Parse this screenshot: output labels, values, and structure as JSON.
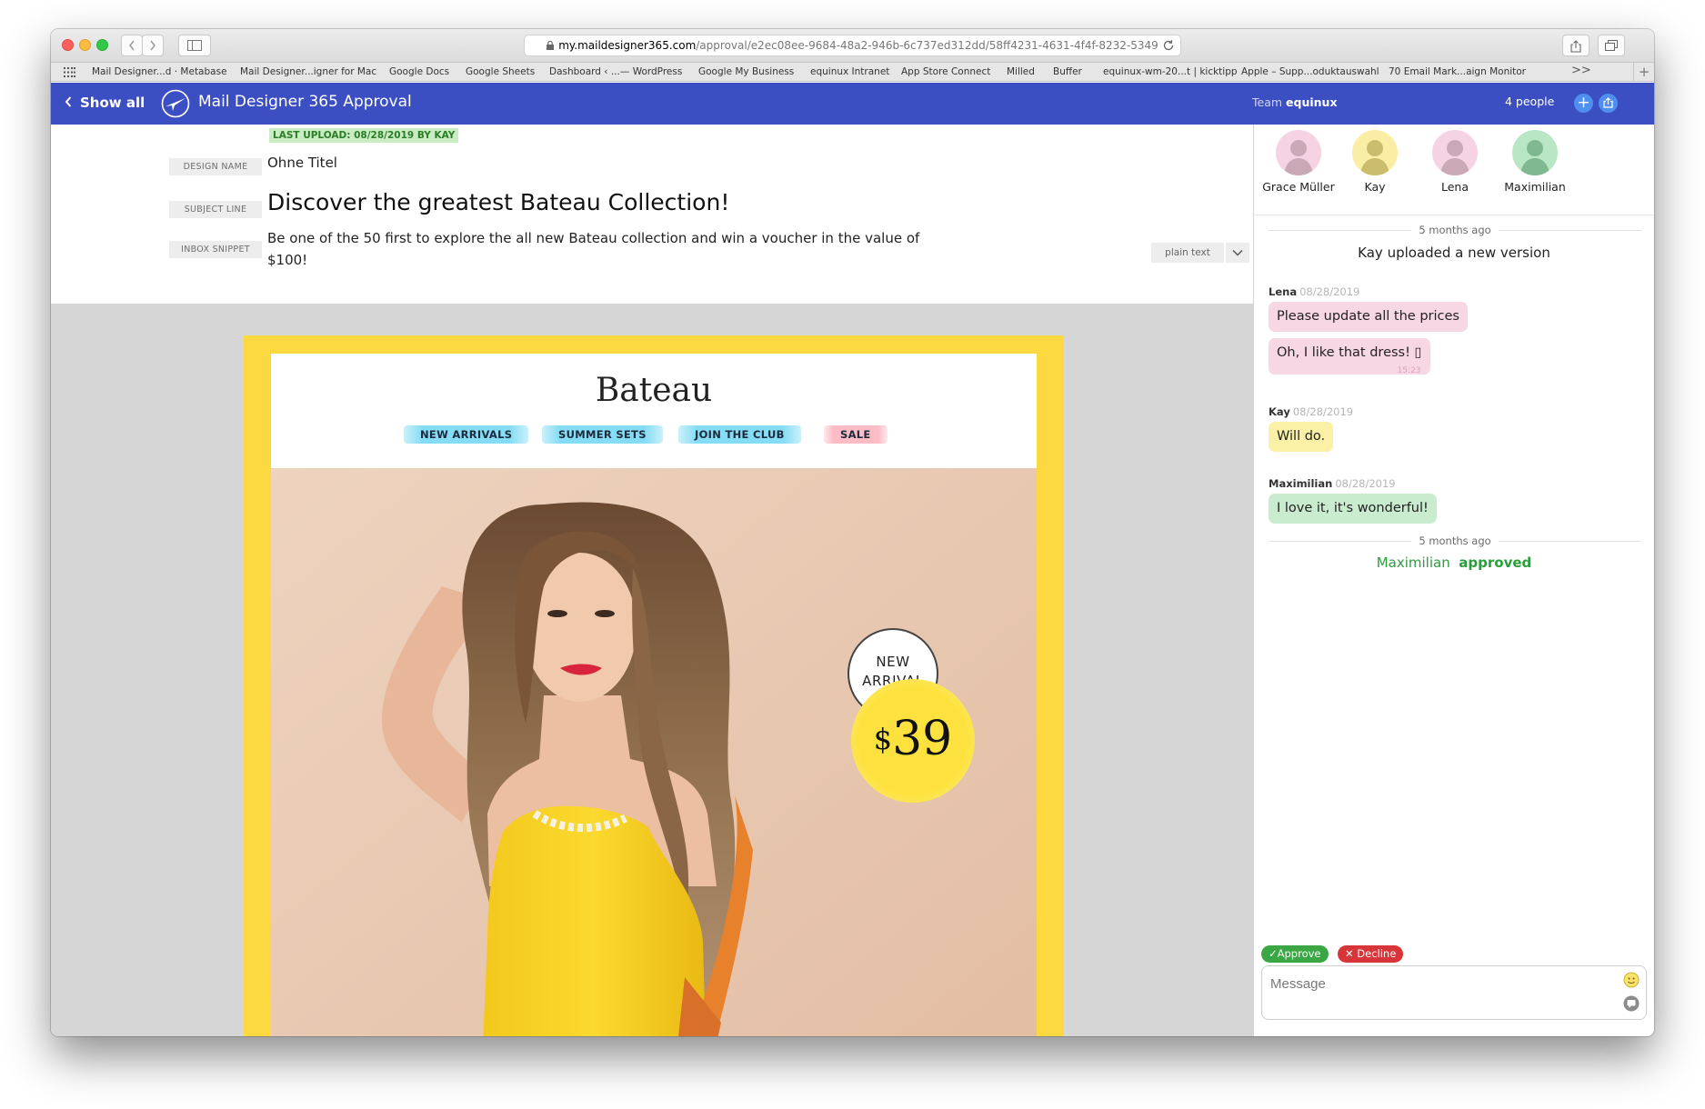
{
  "browser": {
    "url_host": "my.maildesigner365.com",
    "url_path": "/approval/e2ec08ee-9684-48a2-946b-6c737ed312dd/58ff4231-4631-4f4f-8232-5349",
    "bookmarks": [
      "Mail Designer...d · Metabase",
      "Mail Designer...igner for Mac",
      "Google Docs",
      "Google Sheets",
      "Dashboard ‹ ...— WordPress",
      "Google My Business",
      "equinux Intranet",
      "App Store Connect",
      "Milled",
      "Buffer",
      "equinux-wm-20...t | kicktipp",
      "Apple – Supp...oduktauswahl",
      "70 Email Mark...aign Monitor"
    ],
    "more": ">>",
    "add": "+"
  },
  "header": {
    "back_label": "Show all",
    "app_title": "Mail Designer 365  Approval",
    "team_prefix": "Team",
    "team_name": "equinux",
    "people_count": "4 people",
    "add_person": "+"
  },
  "design": {
    "upload_badge": "LAST UPLOAD: 08/28/2019 BY KAY",
    "labels": {
      "design_name": "DESIGN NAME",
      "subject_line": "SUBJECT LINE",
      "inbox_snippet": "INBOX SNIPPET"
    },
    "design_name": "Ohne Titel",
    "subject": "Discover the greatest Bateau Collection!",
    "snippet": "Be one of the 50 first to explore the all new Bateau collection and win a voucher in the value of $100!",
    "plain_text": "plain text"
  },
  "email": {
    "brand": "Bateau",
    "nav": [
      "NEW ARRIVALS",
      "SUMMER SETS",
      "JOIN THE CLUB",
      "SALE"
    ],
    "badge_line1": "NEW",
    "badge_line2": "ARRIVAL",
    "price_currency": "$",
    "price_amount": "39"
  },
  "participants": [
    {
      "name": "Grace Müller",
      "color": "#f6d3e2"
    },
    {
      "name": "Kay",
      "color": "#f9eea3"
    },
    {
      "name": "Lena",
      "color": "#f6d3e2"
    },
    {
      "name": "Maximilian",
      "color": "#b9e6c5"
    }
  ],
  "conversation": {
    "sep1": "5 months ago",
    "sys_upload": "Kay uploaded a new version",
    "messages": [
      {
        "author": "Lena",
        "date": "08/28/2019",
        "texts": [
          "Please update all the prices",
          "Oh, I like that dress! ▯"
        ],
        "time": "15:23"
      },
      {
        "author": "Kay",
        "date": "08/28/2019",
        "texts": [
          "Will do."
        ]
      },
      {
        "author": "Maximilian",
        "date": "08/28/2019",
        "texts": [
          "I love it, it's wonderful!"
        ]
      }
    ],
    "sep2": "5 months ago",
    "approval_name": "Maximilian",
    "approval_word": "approved"
  },
  "actions": {
    "approve": "✓Approve",
    "decline": "✕ Decline",
    "message_placeholder": "Message"
  },
  "colors": {
    "header_blue": "#3c4fc2",
    "approve_green": "#3aa744",
    "decline_red": "#d63639",
    "frame_yellow": "#fdd941"
  }
}
